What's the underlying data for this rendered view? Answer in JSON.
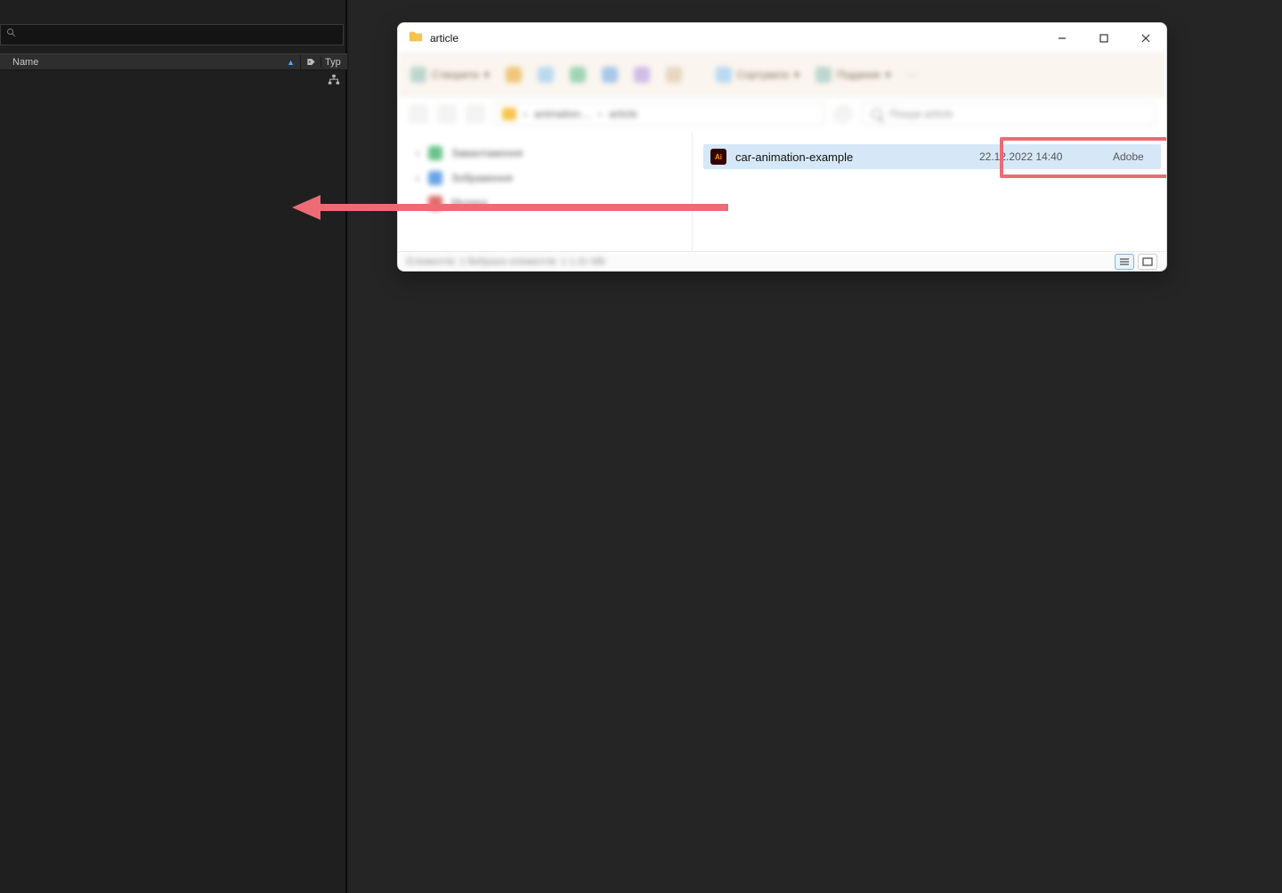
{
  "ae_panel": {
    "search_placeholder": "",
    "columns": {
      "name": "Name",
      "type": "Typ"
    }
  },
  "explorer": {
    "title": "article",
    "toolbar": {
      "btn1": "Створити",
      "btn2": "Сортувати",
      "btn3": "Подання"
    },
    "breadcrumb": {
      "part1": "animation…",
      "part2": "article"
    },
    "search_placeholder": "Пошук article",
    "nav": {
      "item1": "Завантаження",
      "item2": "Зображення",
      "item3": "Музика"
    },
    "status": {
      "text": "Елементів: 1    Вибрано елементів: 1  1,31 МБ"
    },
    "file": {
      "icon_text": "Ai",
      "name": "car-animation-example",
      "date": "22.12.2022 14:40",
      "type": "Adobe"
    }
  }
}
